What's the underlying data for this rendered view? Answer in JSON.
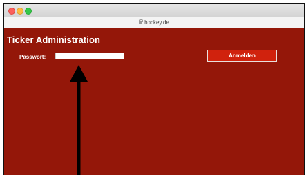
{
  "browser": {
    "url": "hockey.de"
  },
  "page": {
    "title": "Ticker Administration",
    "password_label": "Passwort:",
    "password_value": "",
    "login_button": "Anmelden"
  },
  "colors": {
    "page_background": "#941709",
    "button_background": "#d0220d",
    "text": "#ffffff"
  },
  "annotations": {
    "arrow_color": "#000000"
  }
}
